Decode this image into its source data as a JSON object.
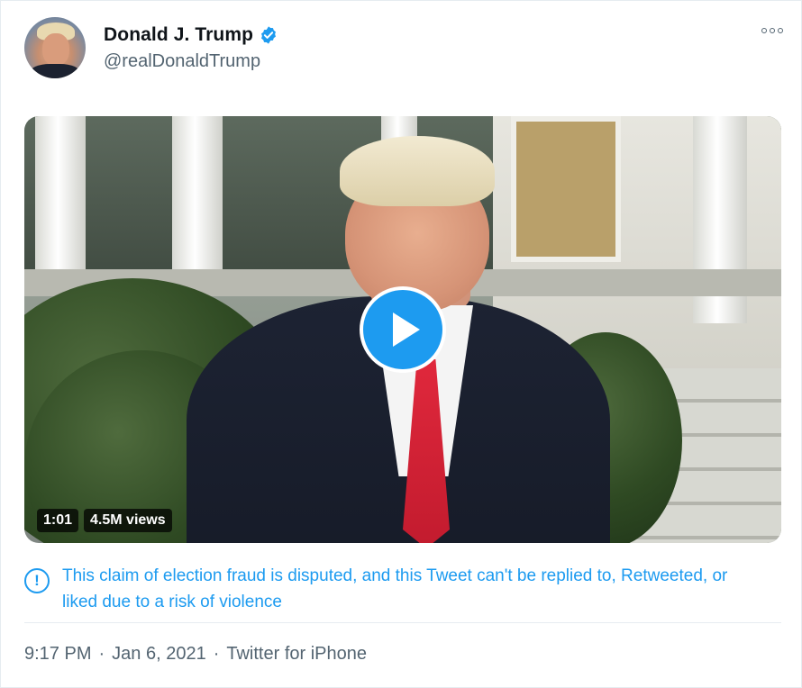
{
  "author": {
    "display_name": "Donald J. Trump",
    "handle": "@realDonaldTrump",
    "verified": true
  },
  "video": {
    "duration": "1:01",
    "views": "4.5M views"
  },
  "notice": {
    "text": "This claim of election fraud is disputed, and this Tweet can't be replied to, Retweeted, or liked due to a risk of violence"
  },
  "footer": {
    "time": "9:17 PM",
    "date": "Jan 6, 2021",
    "source": "Twitter for iPhone",
    "separator": "·"
  },
  "colors": {
    "accent": "#1d9bf0",
    "secondary_text": "#536471"
  },
  "icons": {
    "verified": "verified-badge-icon",
    "more": "more-options-icon",
    "play": "play-icon",
    "notice": "exclamation-circle-icon"
  }
}
